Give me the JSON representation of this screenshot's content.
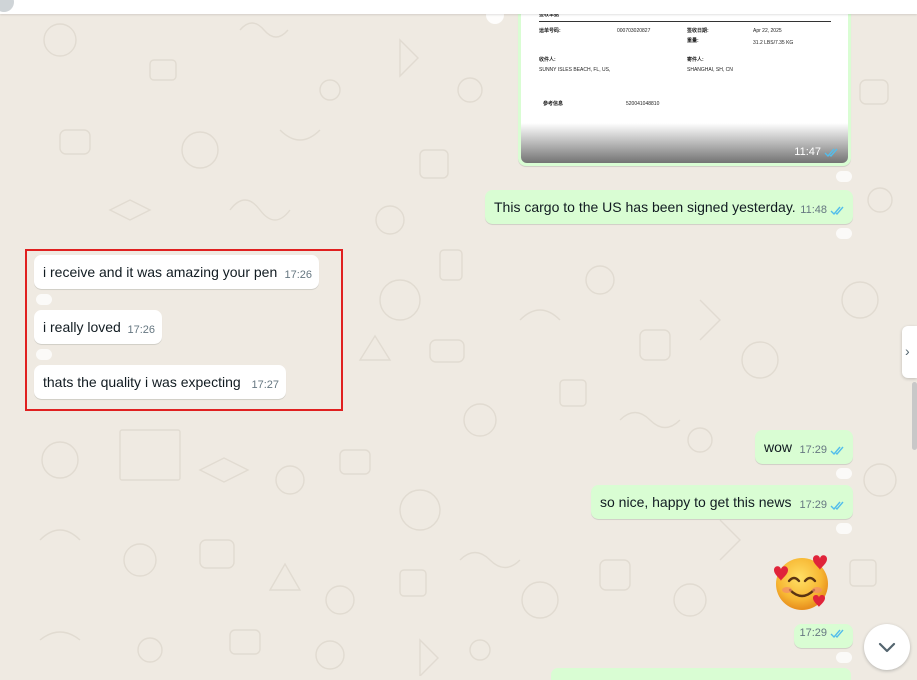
{
  "document_image": {
    "time": "11:47",
    "fields": [
      "签收单据",
      "运单号码:",
      "000703020827",
      "签收日期:",
      "Apr 22, 2025",
      "重量:",
      "31.2 LBS/7.35 KG",
      "收件人:",
      "SUNNY ISLES BEACH, FL, US,",
      "寄件人:",
      "SHANGHAI, SH, CN",
      "参考信息",
      "520041048810"
    ]
  },
  "messages": [
    {
      "id": "cargo",
      "direction": "out",
      "text": "This cargo to the US has been signed yesterday.",
      "time": "11:48"
    },
    {
      "id": "pen",
      "direction": "in",
      "text": "i receive and it was amazing your pen",
      "time": "17:26"
    },
    {
      "id": "loved",
      "direction": "in",
      "text": "i really loved",
      "time": "17:26"
    },
    {
      "id": "quality",
      "direction": "in",
      "text": "thats the quality i was expecting",
      "time": "17:27"
    },
    {
      "id": "wow",
      "direction": "out",
      "text": "wow",
      "time": "17:29"
    },
    {
      "id": "nice",
      "direction": "out",
      "text": "so nice, happy to get this news",
      "time": "17:29"
    },
    {
      "id": "emoji",
      "direction": "out",
      "text": "",
      "time": "17:29"
    }
  ],
  "icons": {
    "read_receipt": "double-check-icon",
    "reaction": "react-emoji-icon",
    "side_tab": "chevron-right-icon",
    "scroll_down": "chevron-down-icon",
    "emoji": "smiling-face-with-hearts"
  },
  "colors": {
    "incoming_bubble": "#ffffff",
    "outgoing_bubble": "#d9fdd3",
    "read_tick": "#53bdeb",
    "highlight": "#e02020",
    "wallpaper": "#efeae2"
  },
  "nav": {
    "side_tab_glyph": "›"
  }
}
